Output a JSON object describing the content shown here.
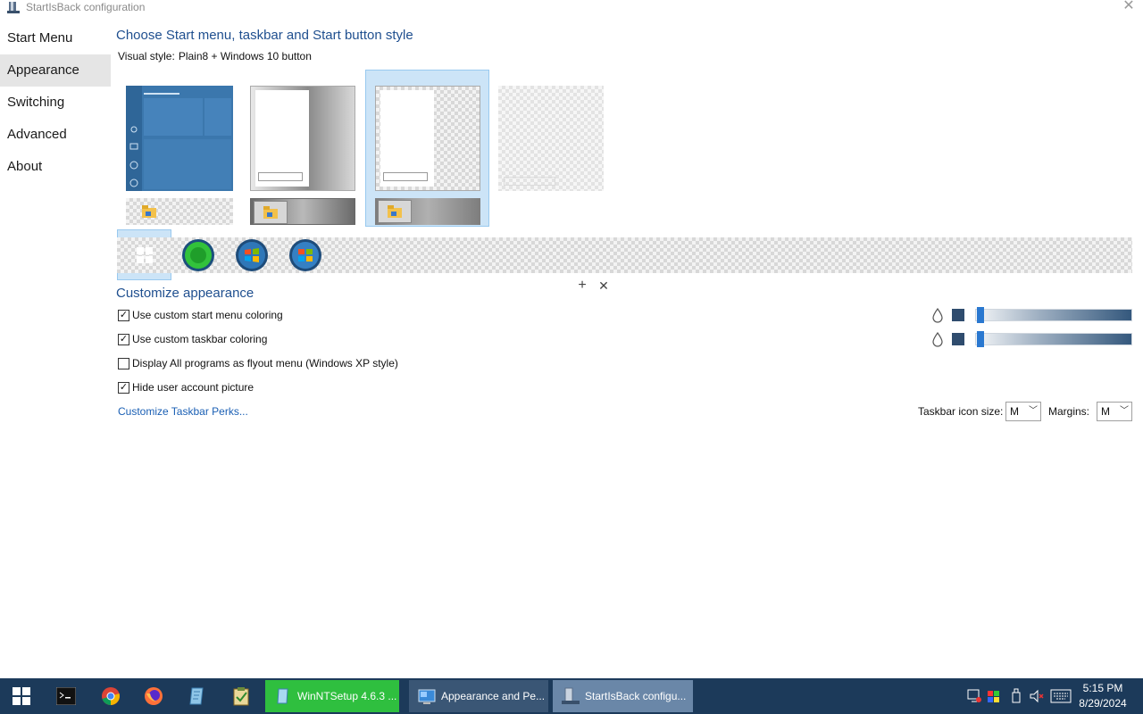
{
  "window": {
    "title": "StartIsBack configuration",
    "close_glyph": "✕"
  },
  "nav": {
    "items": [
      {
        "label": "Start Menu"
      },
      {
        "label": "Appearance",
        "selected": true
      },
      {
        "label": "Switching"
      },
      {
        "label": "Advanced"
      },
      {
        "label": "About"
      }
    ]
  },
  "main": {
    "heading": "Choose Start menu, taskbar and Start button style",
    "visual_style_label": "Visual style:",
    "visual_style_value": "Plain8 + Windows 10 button",
    "add_glyph": "+",
    "remove_glyph": "✕"
  },
  "customize": {
    "heading": "Customize appearance",
    "options": [
      {
        "label": "Use custom start menu coloring",
        "checked": true,
        "glyph": "✓"
      },
      {
        "label": "Use custom taskbar coloring",
        "checked": true,
        "glyph": "✓"
      },
      {
        "label": "Display All programs as flyout menu (Windows XP style)",
        "checked": false,
        "glyph": ""
      },
      {
        "label": "Hide user account picture",
        "checked": true,
        "glyph": "✓"
      }
    ],
    "perks_link": "Customize Taskbar Perks...",
    "taskbar_icon_size_label": "Taskbar icon size:",
    "taskbar_icon_size_value": "M",
    "margins_label": "Margins:",
    "margins_value": "M",
    "colors": {
      "start_menu_swatch": "#2f4c6e",
      "taskbar_swatch": "#2f4c6e",
      "accent": "#1f4f8f",
      "selection": "#cce4f7"
    }
  },
  "taskbar": {
    "pinned": [
      "start-icon",
      "terminal-icon",
      "chrome-icon",
      "firefox-icon",
      "notepad-icon",
      "clipboard-icon"
    ],
    "tasks": [
      {
        "label": "WinNTSetup 4.6.3 ..."
      },
      {
        "label": "Appearance and Pe..."
      },
      {
        "label": "StartIsBack configu..."
      }
    ],
    "clock_time": "5:15 PM",
    "clock_date": "8/29/2024"
  }
}
